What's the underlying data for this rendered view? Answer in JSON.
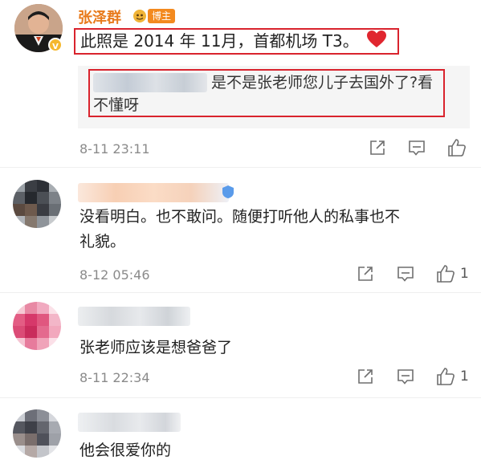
{
  "colors": {
    "brand_orange": "#e87a1b",
    "highlight_red": "#d9232d",
    "heart_red": "#e0262f",
    "meta_gray": "#8a8a8a",
    "reply_bg": "#f5f5f5"
  },
  "comments": [
    {
      "author": "张泽群",
      "badge": "博主",
      "verified": true,
      "text": "此照是 2014 年 11月，首都机场 T3。",
      "emoji": "red-heart",
      "reply": {
        "text": "是不是张老师您儿子去国外了?看不懂呀"
      },
      "time": "8-11 23:11",
      "likes": ""
    },
    {
      "author": "",
      "text_line1": "没看明白。也不敢问。随便打听他人的私事也不",
      "text_line2": "礼貌。",
      "time": "8-12 05:46",
      "likes": "1"
    },
    {
      "author": "",
      "text": "张老师应该是想爸爸了",
      "time": "8-11 22:34",
      "likes": "1"
    },
    {
      "author": "",
      "text": "他会很爱你的"
    }
  ]
}
